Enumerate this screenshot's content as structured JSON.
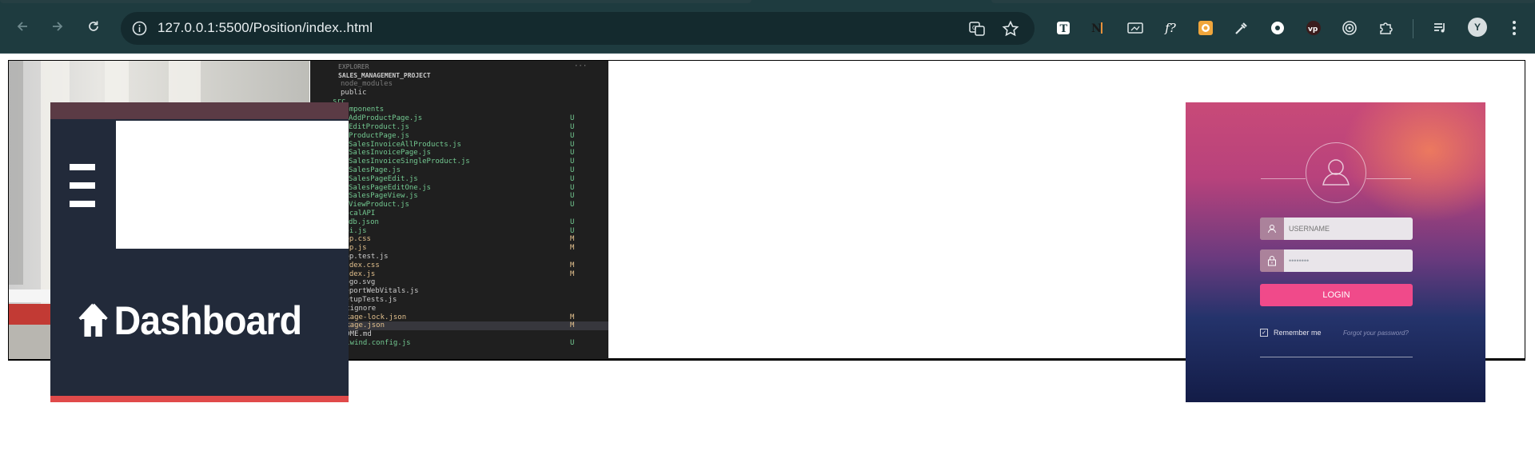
{
  "browser": {
    "url": "127.0.0.1:5500/Position/index..html",
    "extensions": [
      "T",
      "N",
      "screen",
      "f?",
      "color",
      "dropper",
      "circle",
      "vp",
      "target",
      "puzzle"
    ],
    "avatar_initial": "Y"
  },
  "explorer": {
    "header": "EXPLORER",
    "project": "SALES_MANAGEMENT_PROJECT",
    "rows": [
      {
        "label": "node_modules",
        "status": "",
        "color": "#7a7a7a"
      },
      {
        "label": "public",
        "status": "",
        "color": "#cccccc"
      },
      {
        "label": "src",
        "status": "",
        "color": "#73c991"
      },
      {
        "label": "components",
        "status": "",
        "color": "#73c991"
      },
      {
        "label": "AddProductPage.js",
        "status": "U",
        "color": "#73c991"
      },
      {
        "label": "EditProduct.js",
        "status": "U",
        "color": "#73c991"
      },
      {
        "label": "ProductPage.js",
        "status": "U",
        "color": "#73c991"
      },
      {
        "label": "SalesInvoiceAllProducts.js",
        "status": "U",
        "color": "#73c991"
      },
      {
        "label": "SalesInvoicePage.js",
        "status": "U",
        "color": "#73c991"
      },
      {
        "label": "SalesInvoiceSingleProduct.js",
        "status": "U",
        "color": "#73c991"
      },
      {
        "label": "SalesPage.js",
        "status": "U",
        "color": "#73c991"
      },
      {
        "label": "SalesPageEdit.js",
        "status": "U",
        "color": "#73c991"
      },
      {
        "label": "SalesPageEditOne.js",
        "status": "U",
        "color": "#73c991"
      },
      {
        "label": "SalesPageView.js",
        "status": "U",
        "color": "#73c991"
      },
      {
        "label": "ViewProduct.js",
        "status": "U",
        "color": "#73c991"
      },
      {
        "label": "localAPI",
        "status": "",
        "color": "#73c991"
      },
      {
        "label": "db.json",
        "status": "U",
        "color": "#73c991"
      },
      {
        "label": "api.js",
        "status": "U",
        "color": "#73c991"
      },
      {
        "label": "App.css",
        "status": "M",
        "color": "#e2c08d"
      },
      {
        "label": "App.js",
        "status": "M",
        "color": "#e2c08d"
      },
      {
        "label": "App.test.js",
        "status": "",
        "color": "#cccccc"
      },
      {
        "label": "index.css",
        "status": "M",
        "color": "#e2c08d"
      },
      {
        "label": "index.js",
        "status": "M",
        "color": "#e2c08d"
      },
      {
        "label": "logo.svg",
        "status": "",
        "color": "#cccccc"
      },
      {
        "label": "reportWebVitals.js",
        "status": "",
        "color": "#cccccc"
      },
      {
        "label": "setupTests.js",
        "status": "",
        "color": "#cccccc"
      },
      {
        "label": ".gitignore",
        "status": "",
        "color": "#cccccc"
      },
      {
        "label": "package-lock.json",
        "status": "M",
        "color": "#e2c08d"
      },
      {
        "label": "package.json",
        "status": "M",
        "color": "#e2c08d"
      },
      {
        "label": "README.md",
        "status": "",
        "color": "#cccccc"
      },
      {
        "label": "tailwind.config.js",
        "status": "U",
        "color": "#73c991"
      }
    ]
  },
  "dashboard": {
    "title": "Dashboard"
  },
  "login": {
    "username_placeholder": "USERNAME",
    "password_value": "••••••••",
    "login_button": "LOGIN",
    "remember_me": "Remember me",
    "forgot_password": "Forgot your password?"
  }
}
